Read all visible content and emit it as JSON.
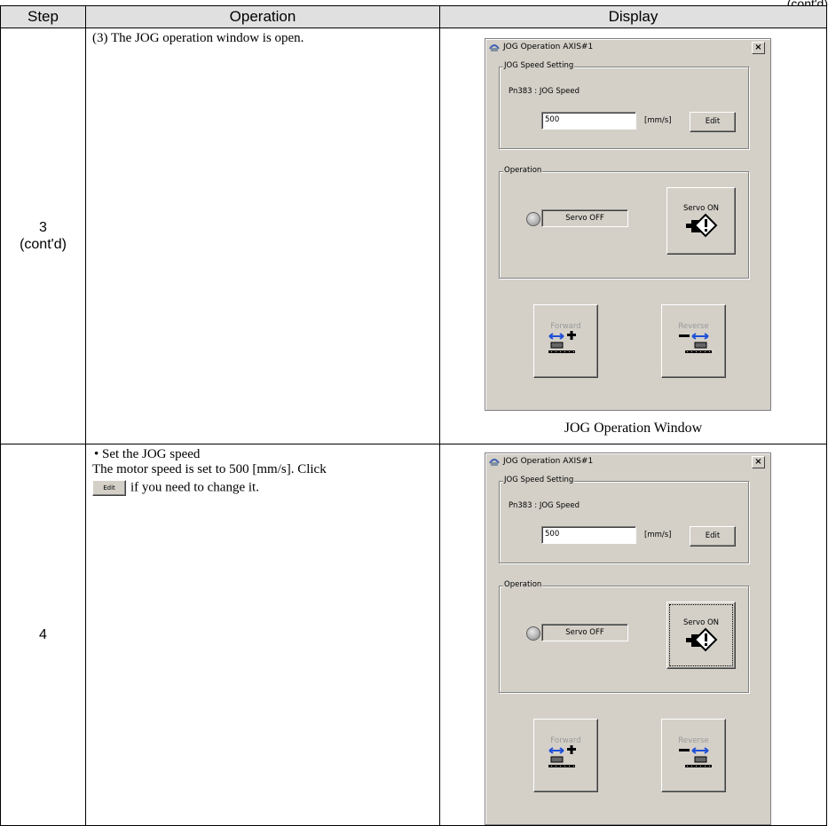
{
  "continuation_tag": "(cont'd)",
  "table": {
    "headers": [
      "Step",
      "Operation",
      "Display"
    ],
    "rows": [
      {
        "step_line1": "3",
        "step_line2": "(cont'd)",
        "operation": "(3) The JOG operation window is open.",
        "caption": "JOG Operation Window"
      },
      {
        "step_line1": "4",
        "bullet": "• Set the JOG speed",
        "text_before": "The motor speed is set to 500 [mm/s]. Click",
        "inline_button": "Edit",
        "text_after": "if you need to change it."
      }
    ]
  },
  "window": {
    "title": "JOG Operation AXIS#1",
    "close": "×",
    "speed_group": "JOG Speed Setting",
    "param_label": "Pn383 : JOG Speed",
    "speed_value": "500",
    "unit": "[mm/s]",
    "edit_label": "Edit",
    "operation_group": "Operation",
    "servo_status": "Servo OFF",
    "servo_button": "Servo ON",
    "forward": "Forward",
    "reverse": "Reverse"
  },
  "colors": {
    "window_bg": "#d4d0c8",
    "arrow_blue": "#1f4fd8"
  }
}
